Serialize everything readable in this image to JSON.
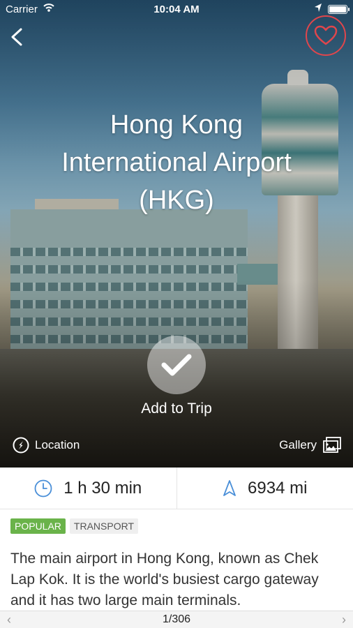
{
  "status_bar": {
    "carrier": "Carrier",
    "time": "10:04 AM"
  },
  "hero": {
    "title_lines": [
      "Hong Kong",
      "International Airport",
      "(HKG)"
    ],
    "add_to_trip_label": "Add to Trip",
    "location_label": "Location",
    "gallery_label": "Gallery"
  },
  "stats": {
    "duration": "1 h 30 min",
    "distance": "6934 mi"
  },
  "tags": [
    "POPULAR",
    "TRANSPORT"
  ],
  "description": "The main airport in Hong Kong, known as Chek Lap Kok. It is the world's busiest cargo gateway and it has two large main terminals.",
  "pager": {
    "label": "1/306",
    "prev": "‹",
    "next": "›"
  },
  "colors": {
    "favorite_accent": "#e0464c",
    "popular_tag": "#6ab34a",
    "icon_blue": "#4a8fd8"
  },
  "icons": [
    "back-chevron",
    "heart",
    "checkmark",
    "compass",
    "gallery",
    "clock",
    "navigation-arrow"
  ]
}
